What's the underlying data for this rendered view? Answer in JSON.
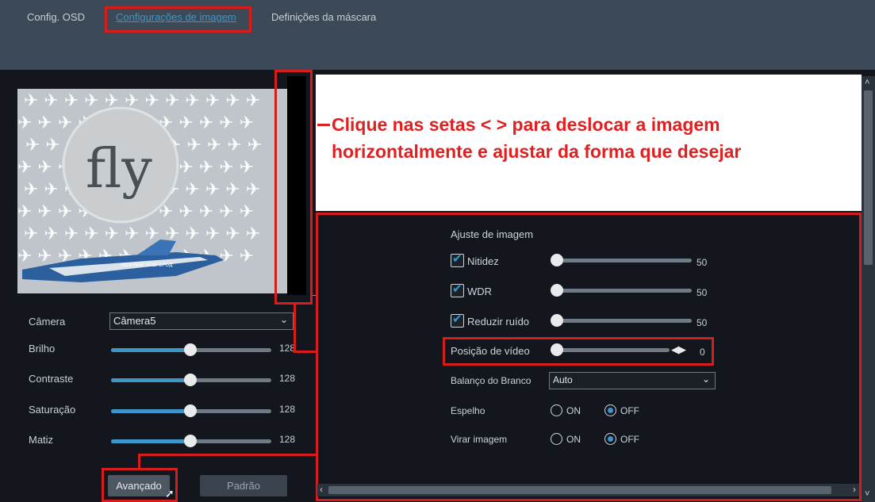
{
  "tabs": [
    {
      "label": "Config. OSD",
      "active": false
    },
    {
      "label": "Configurações de imagem",
      "active": true
    },
    {
      "label": "Definições da máscara",
      "active": false
    }
  ],
  "preview": {
    "logo_text": "fly",
    "jet_text": "НИЖНИЙ НОВГОРОД"
  },
  "left_settings": {
    "camera_label": "Câmera",
    "camera_value": "Câmera5",
    "sliders": [
      {
        "label": "Brilho",
        "value": "128",
        "fraction": 0.5
      },
      {
        "label": "Contraste",
        "value": "128",
        "fraction": 0.5
      },
      {
        "label": "Saturação",
        "value": "128",
        "fraction": 0.5
      },
      {
        "label": "Matiz",
        "value": "128",
        "fraction": 0.5
      }
    ],
    "advanced_button": "Avançado",
    "default_button": "Padrão"
  },
  "annotation": {
    "line1": "Clique nas setas < > para deslocar a imagem",
    "line2": "horizontalmente e ajustar da forma que desejar"
  },
  "advanced": {
    "section_title": "Ajuste de imagem",
    "checked_sliders": [
      {
        "label": "Nitidez",
        "value": "50",
        "checked": true,
        "fraction": 0.0
      },
      {
        "label": "WDR",
        "value": "50",
        "checked": true,
        "fraction": 0.0
      },
      {
        "label": "Reduzir ruído",
        "value": "50",
        "checked": true,
        "fraction": 0.0
      }
    ],
    "video_position": {
      "label": "Posição de vídeo",
      "value": "0",
      "arrows": "◀▶"
    },
    "white_balance": {
      "label": "Balanço do Branco",
      "value": "Auto"
    },
    "mirror": {
      "label": "Espelho",
      "on": "ON",
      "off": "OFF",
      "selected": "OFF"
    },
    "flip": {
      "label": "Virar imagem",
      "on": "ON",
      "off": "OFF",
      "selected": "OFF"
    }
  },
  "colors": {
    "accent": "#3f94c8",
    "annotation_red": "#d81b1b"
  }
}
